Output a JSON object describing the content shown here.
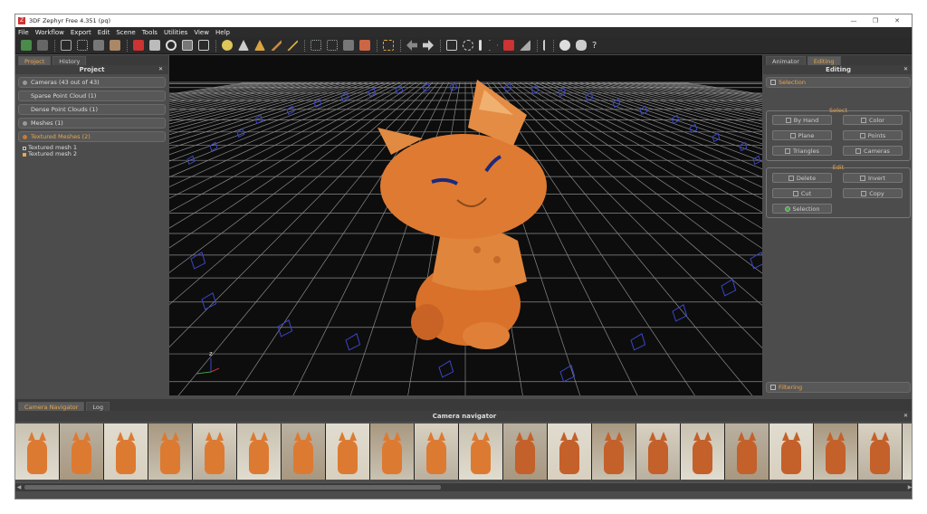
{
  "window": {
    "title": "3DF Zephyr Free 4.351 (pq)",
    "controls": [
      "—",
      "❐",
      "✕"
    ]
  },
  "menu": [
    "File",
    "Workflow",
    "Export",
    "Edit",
    "Scene",
    "Tools",
    "Utilities",
    "View",
    "Help"
  ],
  "toolbar": {
    "help_label": "?"
  },
  "left_panel": {
    "tabs": [
      "Project",
      "History"
    ],
    "title": "Project",
    "close": "✕",
    "items": [
      {
        "label": "Cameras (43 out of 43)",
        "selected": false
      },
      {
        "label": "Sparse Point Cloud (1)",
        "selected": false
      },
      {
        "label": "Dense Point Clouds (1)",
        "selected": false
      },
      {
        "label": "Meshes (1)",
        "selected": false
      },
      {
        "label": "Textured Meshes (2)",
        "selected": true
      }
    ],
    "sub_items": [
      "Textured mesh 1",
      "Textured mesh 2"
    ]
  },
  "viewport": {
    "axis_z": "z",
    "axis_x": "x"
  },
  "right_panel": {
    "tabs": [
      "Animator",
      "Editing"
    ],
    "title": "Editing",
    "close": "✕",
    "selection_label": "Selection",
    "select_group": {
      "label": "Select",
      "buttons": [
        "By Hand",
        "Color",
        "Plane",
        "Points",
        "Triangles",
        "Cameras"
      ]
    },
    "edit_group": {
      "label": "Edit",
      "buttons": [
        "Delete",
        "Invert",
        "Cut",
        "Copy",
        "Selection"
      ]
    },
    "filtering_label": "Filtering"
  },
  "bottom_panel": {
    "tabs": [
      "Camera Navigator",
      "Log"
    ],
    "title": "Camera navigator",
    "close": "✕",
    "thumbnail_count": 21
  },
  "colors": {
    "accent": "#e8a64e",
    "panel": "#4c4c4c",
    "viewport": "#0d0d0d",
    "camera": "#3a46c8",
    "model": "#d9712a"
  }
}
